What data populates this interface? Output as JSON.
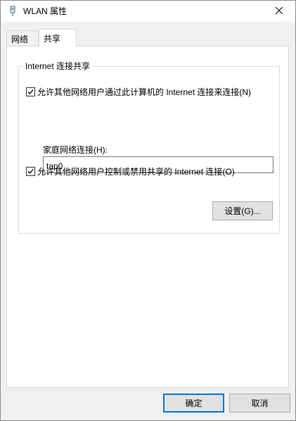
{
  "window": {
    "title": "WLAN 属性",
    "icons": {
      "title": "network-adapter-icon",
      "close": "close-icon"
    }
  },
  "tabs": [
    {
      "label": "网络",
      "active": false
    },
    {
      "label": "共享",
      "active": true
    }
  ],
  "group": {
    "legend": "Internet 连接共享",
    "allow_connect": {
      "label": "允许其他网络用户通过此计算机的 Internet 连接来连接(N)",
      "checked": true
    },
    "home_network": {
      "label": "家庭网络连接(H):",
      "value": "tap0"
    },
    "allow_control": {
      "label": "允许其他网络用户控制或禁用共享的 Internet 连接(O)",
      "checked": true
    },
    "settings_button": "设置(G)..."
  },
  "buttons": {
    "ok": "确定",
    "cancel": "取消"
  },
  "colors": {
    "accent": "#0078d7",
    "panel": "#ffffff",
    "chrome": "#f0f0f0"
  }
}
